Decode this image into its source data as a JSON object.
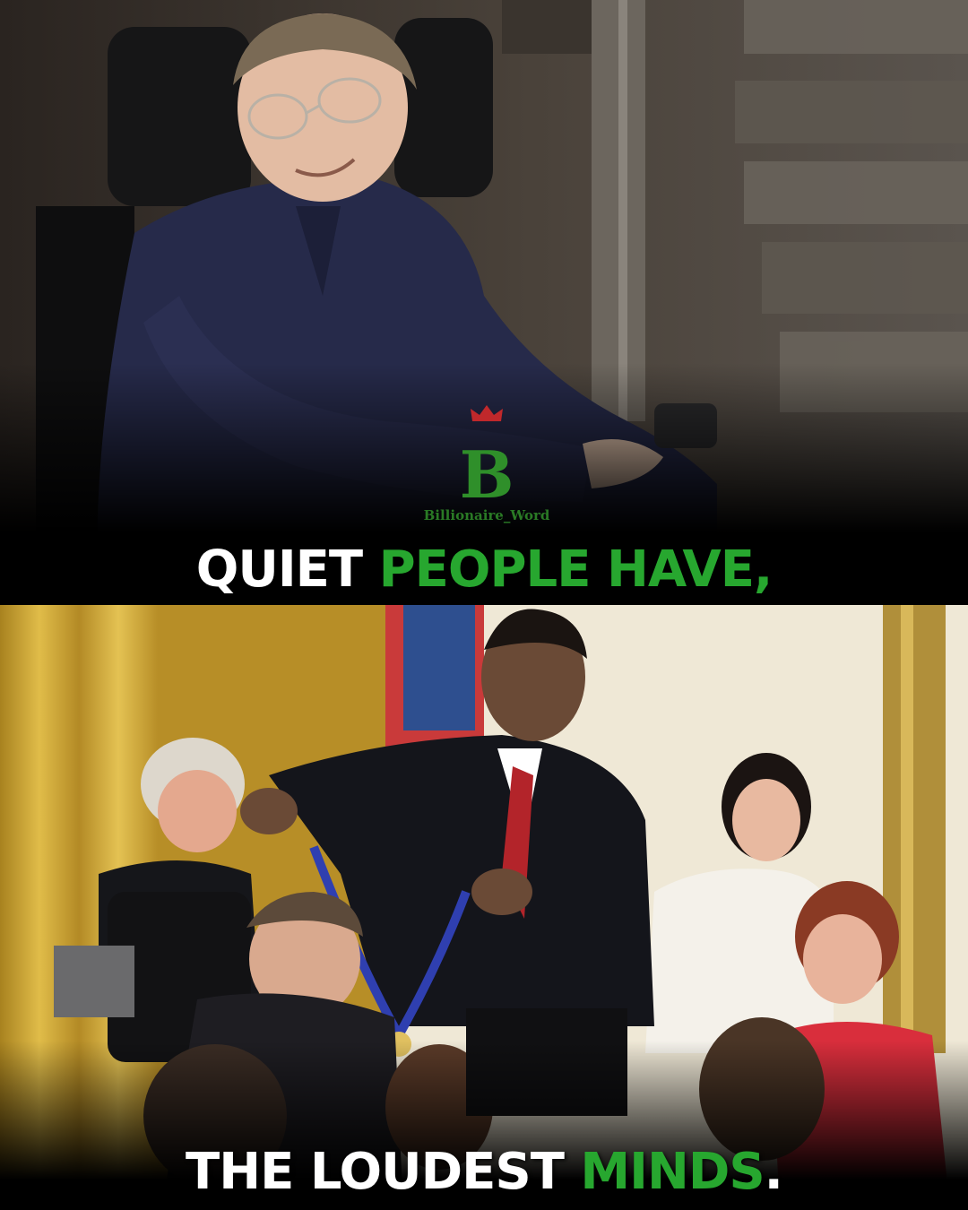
{
  "caption_top": {
    "part1": "QUIET",
    "part2": "PEOPLE HAVE,"
  },
  "caption_bottom": {
    "part1": "THE LOUDEST",
    "part2": "MINDS",
    "part3": "."
  },
  "watermark": {
    "letter": "B",
    "text": "Billionaire_Word"
  },
  "colors": {
    "accent_green": "#27a72f",
    "text_white": "#ffffff",
    "background": "#000000"
  }
}
